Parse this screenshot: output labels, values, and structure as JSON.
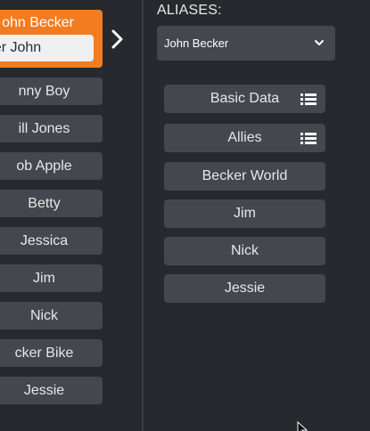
{
  "left": {
    "active_card": {
      "title": "ohn Becker",
      "input_value": "uper John"
    },
    "names": [
      "nny Boy",
      "ill Jones",
      "ob Apple",
      "Betty",
      "Jessica",
      "Jim",
      "Nick",
      "cker Bike",
      "Jessie"
    ]
  },
  "right": {
    "aliases_label": "ALIASES:",
    "alias_select_value": "John Becker",
    "buttons": [
      {
        "label": "Basic Data",
        "icon": "list-icon"
      },
      {
        "label": "Allies",
        "icon": "list-icon"
      },
      {
        "label": "Becker World"
      },
      {
        "label": "Jim"
      },
      {
        "label": "Nick"
      },
      {
        "label": "Jessie"
      }
    ]
  },
  "colors": {
    "background": "#26292d",
    "accent": "#f47c20",
    "button": "#44484e",
    "text": "#e6e7e8"
  }
}
